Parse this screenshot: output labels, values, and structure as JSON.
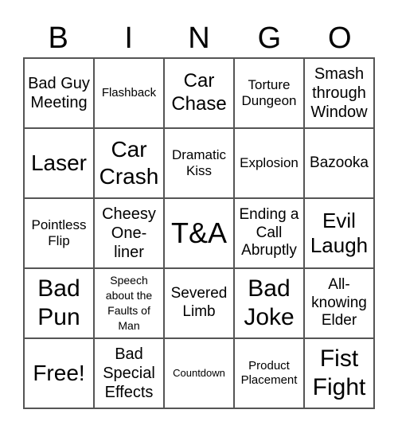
{
  "header": [
    "B",
    "I",
    "N",
    "G",
    "O"
  ],
  "cells": [
    "Bad Guy Meeting",
    "Flashback",
    "Car Chase",
    "Torture Dungeon",
    "Smash through Window",
    "Laser",
    "Car Crash",
    "Dramatic Kiss",
    "Explosion",
    "Bazooka",
    "Pointless Flip",
    "Cheesy One-liner",
    "T&A",
    "Ending a Call Abruptly",
    "Evil Laugh",
    "Bad Pun",
    "Speech about the Faults of Man",
    "Severed Limb",
    "Bad Joke",
    "All-knowing Elder",
    "Free!",
    "Bad Special Effects",
    "Countdown",
    "Product Placement",
    "Fist Fight"
  ]
}
